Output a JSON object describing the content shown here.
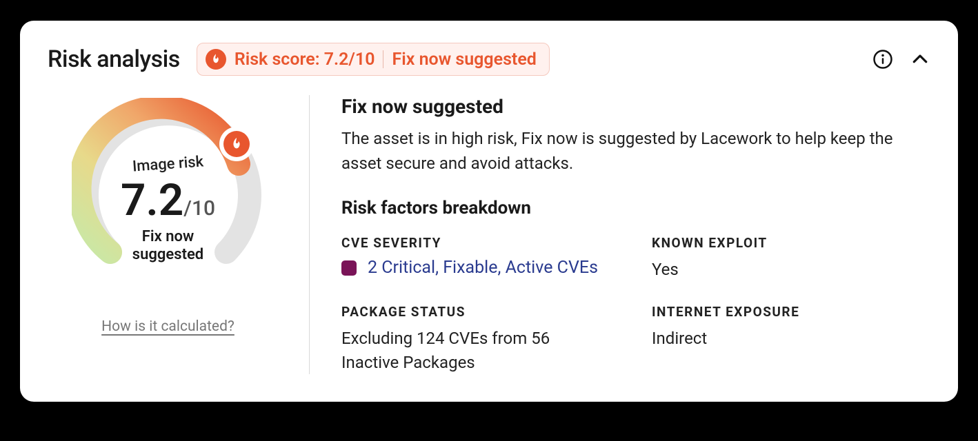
{
  "header": {
    "title": "Risk analysis",
    "score_label": "Risk score: 7.2/10",
    "action_label": "Fix now suggested"
  },
  "gauge": {
    "label": "Image risk",
    "score": "7.2",
    "denominator": "/10",
    "status_line1": "Fix now",
    "status_line2": "suggested",
    "how_link": "How is it calculated?"
  },
  "main": {
    "heading": "Fix now suggested",
    "description": "The asset is in high risk, Fix now is suggested by Lacework to help keep the asset secure and avoid attacks.",
    "breakdown_heading": "Risk factors breakdown"
  },
  "factors": {
    "cve_severity": {
      "label": "CVE SEVERITY",
      "value": "2 Critical, Fixable, Active CVEs",
      "swatch_color": "#7A1458"
    },
    "known_exploit": {
      "label": "KNOWN EXPLOIT",
      "value": "Yes"
    },
    "package_status": {
      "label": "PACKAGE STATUS",
      "value": "Excluding 124 CVEs from 56 Inactive Packages"
    },
    "internet_exposure": {
      "label": "INTERNET EXPOSURE",
      "value": "Indirect"
    }
  },
  "colors": {
    "accent": "#E8562E"
  }
}
